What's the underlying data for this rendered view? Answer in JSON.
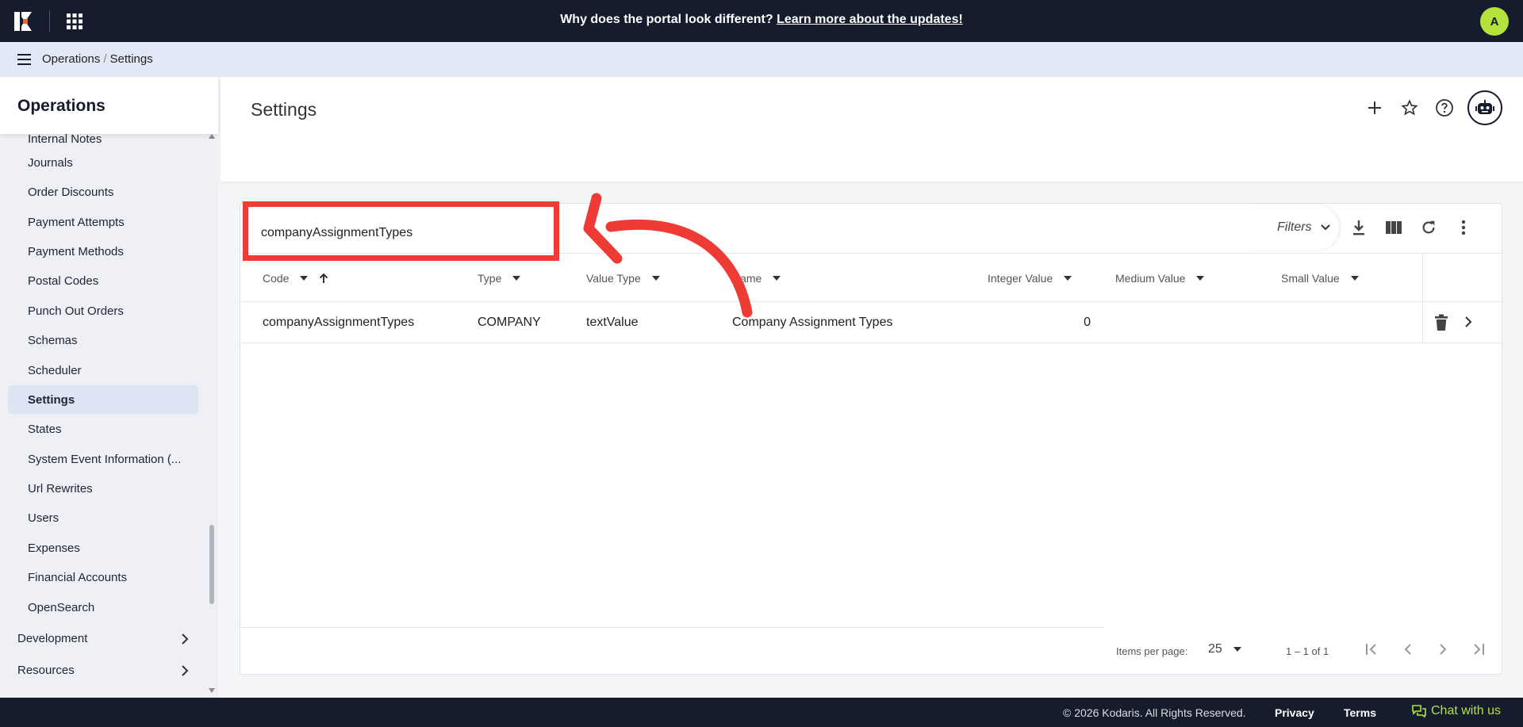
{
  "topbar": {
    "banner_text": "Why does the portal look different?",
    "banner_link": "Learn more about the updates!",
    "avatar_initial": "A",
    "accent_color": "#b6e23c"
  },
  "breadcrumb": {
    "items": [
      "Operations",
      "Settings"
    ]
  },
  "sidebar": {
    "title": "Operations",
    "items": [
      "Internal Notes",
      "Journals",
      "Order Discounts",
      "Payment Attempts",
      "Payment Methods",
      "Postal Codes",
      "Punch Out Orders",
      "Schemas",
      "Scheduler",
      "Settings",
      "States",
      "System Event Information (...",
      "Url Rewrites",
      "Users",
      "Expenses",
      "Financial Accounts",
      "OpenSearch"
    ],
    "active_item": "Settings",
    "groups": [
      "Development",
      "Resources"
    ]
  },
  "page": {
    "title": "Settings"
  },
  "search": {
    "value": "companyAssignmentTypes"
  },
  "toolbar": {
    "filters_label": "Filters"
  },
  "table": {
    "columns": [
      "Code",
      "Type",
      "Value Type",
      "Name",
      "Integer Value",
      "Medium Value",
      "Small Value"
    ],
    "rows": [
      {
        "code": "companyAssignmentTypes",
        "type": "COMPANY",
        "value_type": "textValue",
        "name": "Company Assignment Types",
        "integer_value": "0",
        "medium_value": "",
        "small_value": ""
      }
    ]
  },
  "pagination": {
    "items_per_page_label": "Items per page:",
    "items_per_page": "25",
    "range": "1 – 1 of 1"
  },
  "annotation": {
    "color": "#ef3b36"
  },
  "footer": {
    "copyright": "© 2026 Kodaris. All Rights Reserved.",
    "privacy": "Privacy",
    "terms": "Terms",
    "chat": "Chat with us"
  }
}
